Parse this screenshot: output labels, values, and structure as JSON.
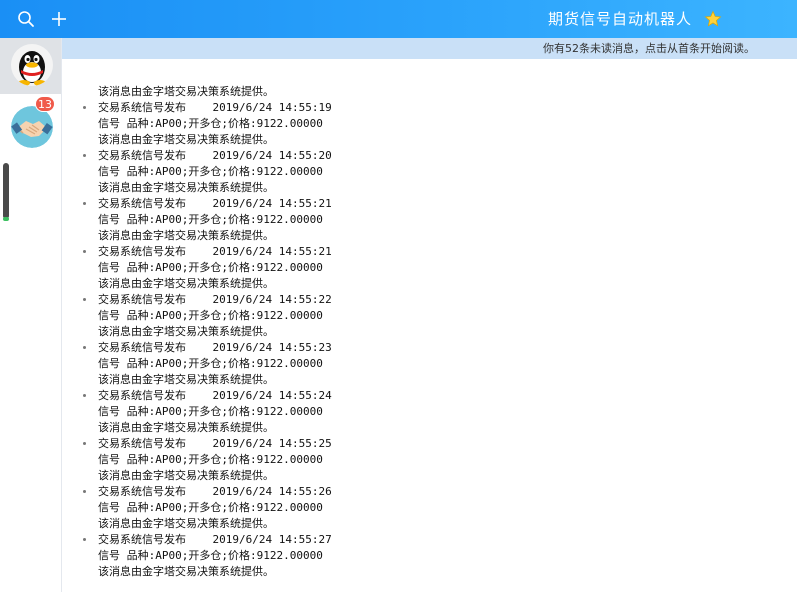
{
  "window": {
    "title": "期货信号自动机器人",
    "title_icon": "star-icon",
    "accent": "#2aa2fb"
  },
  "toolbar": {
    "search_icon": "search-icon",
    "add_icon": "plus-icon"
  },
  "sidebar": {
    "items": [
      {
        "name": "qq-avatar",
        "active": true
      },
      {
        "name": "robot-avatar",
        "active": false,
        "badge": "13"
      }
    ]
  },
  "notice": {
    "text": "你有52条未读消息，点击从首条开始阅读。"
  },
  "messages": {
    "first_footer": "该消息由金字塔交易决策系统提供。",
    "items": [
      {
        "header": "交易系统信号发布    2019/6/24 14:55:19",
        "signal": "信号 品种:AP00;开多仓;价格:9122.00000",
        "footer": "该消息由金字塔交易决策系统提供。"
      },
      {
        "header": "交易系统信号发布    2019/6/24 14:55:20",
        "signal": "信号 品种:AP00;开多仓;价格:9122.00000",
        "footer": "该消息由金字塔交易决策系统提供。"
      },
      {
        "header": "交易系统信号发布    2019/6/24 14:55:21",
        "signal": "信号 品种:AP00;开多仓;价格:9122.00000",
        "footer": "该消息由金字塔交易决策系统提供。"
      },
      {
        "header": "交易系统信号发布    2019/6/24 14:55:21",
        "signal": "信号 品种:AP00;开多仓;价格:9122.00000",
        "footer": "该消息由金字塔交易决策系统提供。"
      },
      {
        "header": "交易系统信号发布    2019/6/24 14:55:22",
        "signal": "信号 品种:AP00;开多仓;价格:9122.00000",
        "footer": "该消息由金字塔交易决策系统提供。"
      },
      {
        "header": "交易系统信号发布    2019/6/24 14:55:23",
        "signal": "信号 品种:AP00;开多仓;价格:9122.00000",
        "footer": "该消息由金字塔交易决策系统提供。"
      },
      {
        "header": "交易系统信号发布    2019/6/24 14:55:24",
        "signal": "信号 品种:AP00;开多仓;价格:9122.00000",
        "footer": "该消息由金字塔交易决策系统提供。"
      },
      {
        "header": "交易系统信号发布    2019/6/24 14:55:25",
        "signal": "信号 品种:AP00;开多仓;价格:9122.00000",
        "footer": "该消息由金字塔交易决策系统提供。"
      },
      {
        "header": "交易系统信号发布    2019/6/24 14:55:26",
        "signal": "信号 品种:AP00;开多仓;价格:9122.00000",
        "footer": "该消息由金字塔交易决策系统提供。"
      },
      {
        "header": "交易系统信号发布    2019/6/24 14:55:27",
        "signal": "信号 品种:AP00;开多仓;价格:9122.00000",
        "footer": "该消息由金字塔交易决策系统提供。"
      }
    ]
  }
}
